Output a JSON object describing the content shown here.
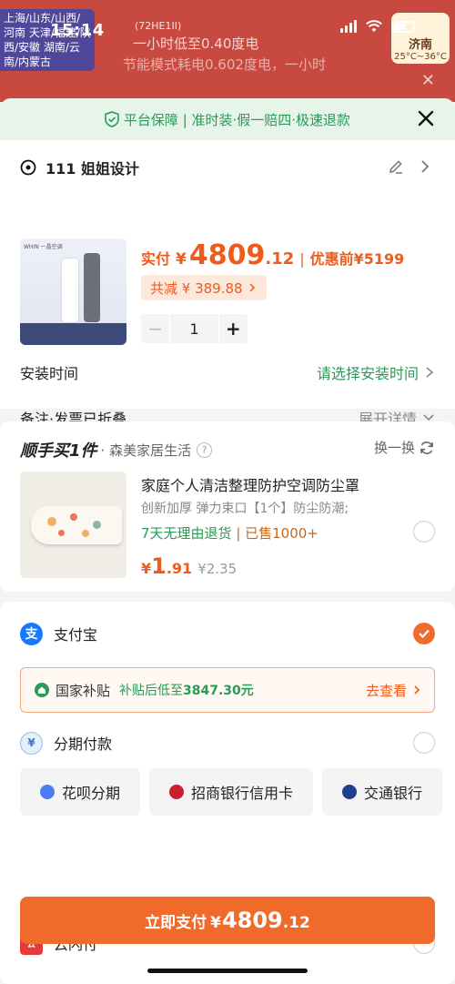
{
  "status_bar": {
    "time": "15:14"
  },
  "background_promo": {
    "regions": "上海/山东/山西/河南 天津/福建/陕西/安徽 湖南/云南/内蒙古",
    "model": "(72HE1II)",
    "line1": "一小时低至0.40度电",
    "line2": "节能模式耗电0.602度电，一小时",
    "city": "济南",
    "temp": "25°C~36°C"
  },
  "guarantee": {
    "text": "平台保障 | 准时装·假一赔四·极速退款"
  },
  "address": {
    "name": "111 姐姐设计"
  },
  "product": {
    "brand_text": "WHIN 一晶空调",
    "actual_label": "实付",
    "currency": "¥",
    "price_int": "4809",
    "price_dec": ".12",
    "separator": "|",
    "before_label": "优惠前¥5199",
    "saving": "共减 ¥ 389.88",
    "quantity": "1"
  },
  "install": {
    "label": "安装时间",
    "value": "请选择安装时间"
  },
  "note": {
    "label": "备注·发票已折叠",
    "value": "展开详情"
  },
  "addon": {
    "title": "顺手买1件",
    "store": "· 森美家居生活",
    "help": "?",
    "swap": "换一换",
    "item_title": "家庭个人清洁整理防护空调防尘罩",
    "item_sub": "创新加厚 弹力束口【1个】防尘防潮;",
    "item_return": "7天无理由退货 ",
    "item_sold": "| 已售1000+",
    "price_yen": "¥",
    "price_int": "1",
    "price_dec": ".91",
    "old_price": "¥2.35"
  },
  "payment": {
    "alipay_label": "支付宝",
    "subsidy_title": "国家补贴",
    "subsidy_desc": "补贴后低至",
    "subsidy_amount": "3847.30元",
    "subsidy_go": "去查看",
    "installment_label": "分期付款",
    "chips": [
      "花呗分期",
      "招商银行信用卡",
      "交通银行"
    ],
    "unionpay_label": "云闪付"
  },
  "pay_button": {
    "label": "立即支付",
    "yen": "¥",
    "int": "4809",
    "dec": ".12"
  },
  "colors": {
    "accent": "#f06a2a",
    "green": "#2a9a57"
  }
}
